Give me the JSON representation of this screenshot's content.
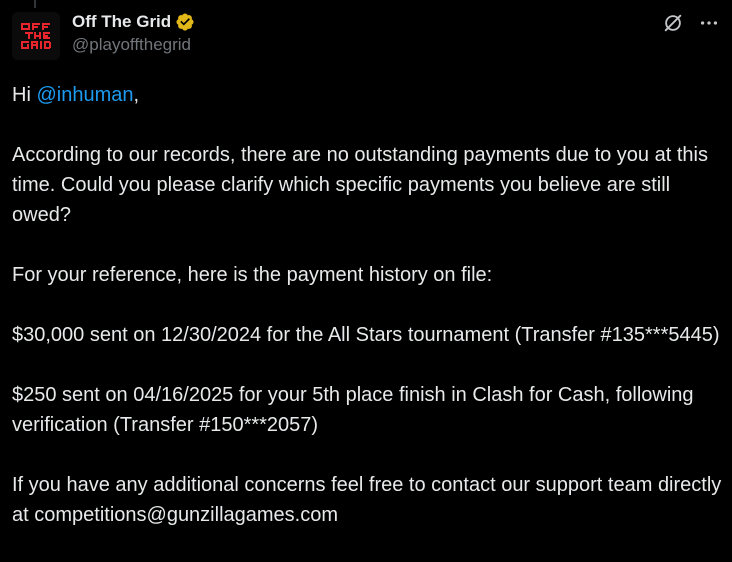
{
  "colors": {
    "background": "#000000",
    "text": "#e7e9ea",
    "secondary": "#71767b",
    "link": "#1d9bf0",
    "verified_badge": "#e2b719",
    "avatar_logo": "#e8242c"
  },
  "post": {
    "author": {
      "display_name": "Off The Grid",
      "handle": "@playoffthegrid",
      "avatar_icon": "off-the-grid-logo",
      "verified_icon": "gold-verified-badge"
    },
    "actions": {
      "grok_icon": "grok-slash-circle-icon",
      "more_icon": "ellipsis-icon"
    },
    "greeting": {
      "prefix": "Hi ",
      "mention": "@inhuman",
      "suffix": ","
    },
    "paragraphs": [
      "According to our records, there are no outstanding payments due to you at this time. Could you please clarify which specific payments you believe are still owed?",
      "For your reference, here is the payment history on file:",
      "$30,000 sent on 12/30/2024 for the All Stars tournament (Transfer #135***5445)",
      "$250 sent on 04/16/2025 for your 5th place finish in Clash for Cash, following verification (Transfer #150***2057)",
      "If you have any additional concerns feel free to contact our support team directly at competitions@gunzillagames.com"
    ]
  }
}
